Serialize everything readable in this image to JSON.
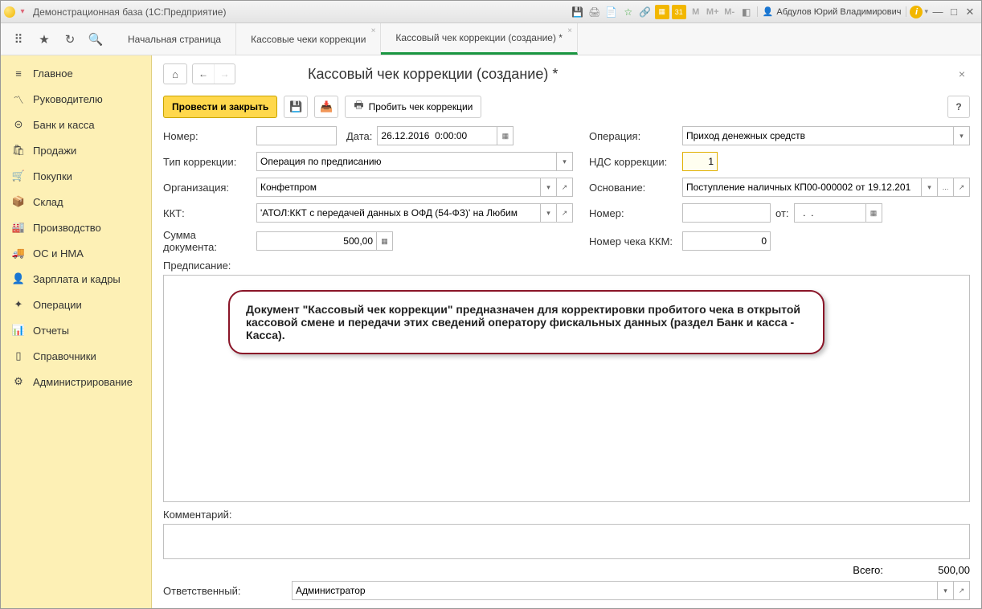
{
  "titlebar": {
    "title": "Демонстрационная база  (1С:Предприятие)",
    "user": "Абдулов Юрий Владимирович",
    "cal": "31"
  },
  "tabs": {
    "start": "Начальная страница",
    "t1": "Кассовые чеки коррекции",
    "t2": "Кассовый чек коррекции (создание) *"
  },
  "sidebar": {
    "items": [
      "Главное",
      "Руководителю",
      "Банк и касса",
      "Продажи",
      "Покупки",
      "Склад",
      "Производство",
      "ОС и НМА",
      "Зарплата и кадры",
      "Операции",
      "Отчеты",
      "Справочники",
      "Администрирование"
    ]
  },
  "page": {
    "title": "Кассовый чек коррекции (создание) *"
  },
  "actions": {
    "post_close": "Провести и закрыть",
    "punch": "Пробить чек коррекции",
    "help": "?"
  },
  "labels": {
    "number": "Номер:",
    "date": "Дата:",
    "operation": "Операция:",
    "corr_type": "Тип коррекции:",
    "vat_corr": "НДС коррекции:",
    "org": "Организация:",
    "basis": "Основание:",
    "kkt": "ККТ:",
    "number2": "Номер:",
    "from": "от:",
    "doc_sum": "Сумма документа:",
    "kkm_num": "Номер чека ККМ:",
    "prescription": "Предписание:",
    "comment": "Комментарий:",
    "total": "Всего:",
    "responsible": "Ответственный:"
  },
  "fields": {
    "number": "",
    "date": "26.12.2016  0:00:00",
    "operation": "Приход денежных средств",
    "corr_type": "Операция по предписанию",
    "vat_corr": "1",
    "org": "Конфетпром",
    "basis": "Поступление наличных КП00-000002 от 19.12.201",
    "basis_more": "...",
    "kkt": "'АТОЛ:ККТ с передачей данных в ОФД (54-ФЗ)' на Любим",
    "number2": "",
    "from_date": "  .  .",
    "doc_sum": "500,00",
    "kkm_num": "0",
    "comment": "",
    "total": "500,00",
    "responsible": "Администратор"
  },
  "callout": "Документ \"Кассовый чек коррекции\" предназначен для корректировки пробитого чека в открытой кассовой смене и передачи этих сведений оператору фискальных данных  (раздел Банк и касса - Касса)."
}
